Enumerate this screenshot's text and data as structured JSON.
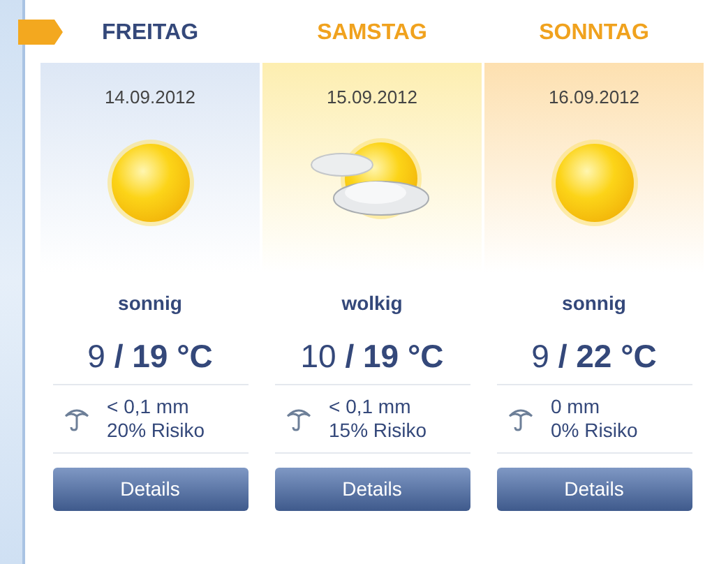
{
  "days": [
    {
      "weekday": "FREITAG",
      "selected": true,
      "color": "#34487a",
      "panel": {
        "color": "#dde7f5"
      },
      "date": "14.09.2012",
      "weather": {
        "kind": "sunny"
      },
      "condition": "sonnig",
      "temperature": "9 **/ 19 °C**",
      "precipitation": "< 0,1 mm",
      "risk": "20% Risiko",
      "button": "Details"
    },
    {
      "weekday": "SAMSTAG",
      "selected": false,
      "color": "#f0a21e",
      "panel": {
        "color": "#fdeeb0"
      },
      "date": "15.09.2012",
      "weather": {
        "kind": "cloudy"
      },
      "condition": "wolkig",
      "temperature": "10 **/ 19 °C**",
      "precipitation": "< 0,1 mm",
      "risk": "15% Risiko",
      "button": "Details"
    },
    {
      "weekday": "SONNTAG",
      "selected": false,
      "color": "#f0a21e",
      "panel": {
        "color": "#fde0b0"
      },
      "date": "16.09.2012",
      "weather": {
        "kind": "sunny"
      },
      "condition": "sonnig",
      "temperature": "9 **/ 22 °C**",
      "precipitation": "0 mm",
      "risk": "0% Risiko",
      "button": "Details"
    }
  ]
}
